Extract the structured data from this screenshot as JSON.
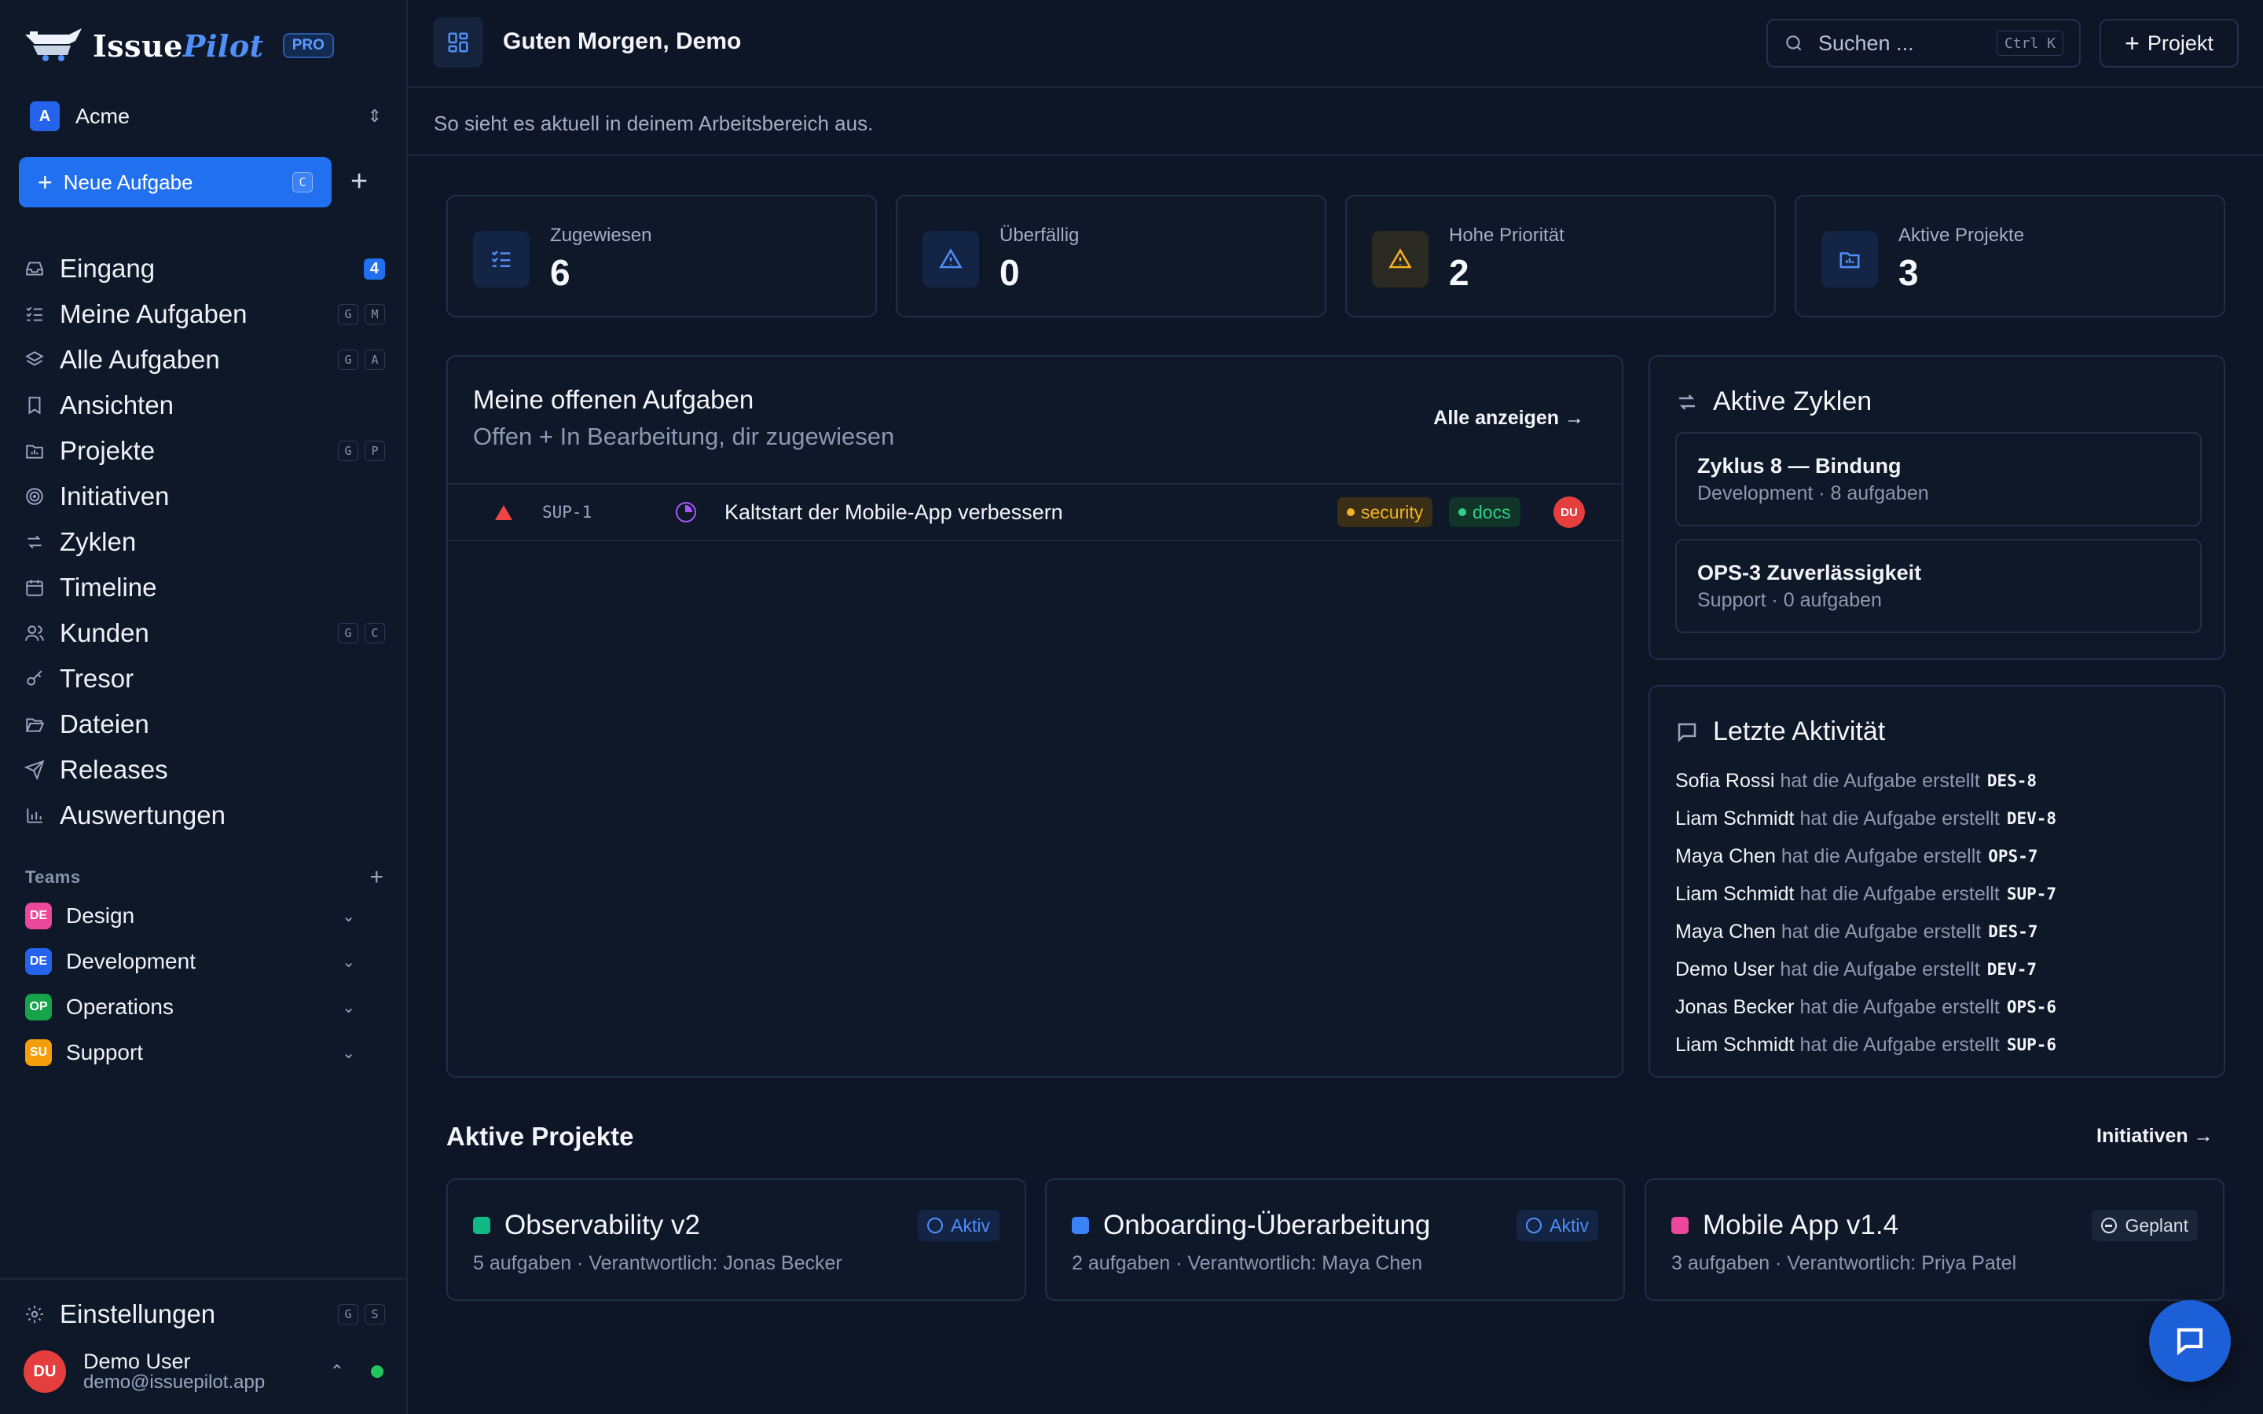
{
  "app": {
    "logo_text_a": "Issue",
    "logo_text_b": "Pilot",
    "plan_badge": "PRO",
    "workspace_initial": "A",
    "workspace_name": "Acme"
  },
  "sidebar": {
    "new_task_label": "Neue Aufgabe",
    "new_task_shortcut": "C",
    "nav": [
      {
        "label": "Eingang",
        "icon": "inbox-icon",
        "badge": "4",
        "keys": []
      },
      {
        "label": "Meine Aufgaben",
        "icon": "list-check-icon",
        "keys": [
          "G",
          "M"
        ]
      },
      {
        "label": "Alle Aufgaben",
        "icon": "layers-icon",
        "keys": [
          "G",
          "A"
        ]
      },
      {
        "label": "Ansichten",
        "icon": "bookmark-icon",
        "keys": []
      },
      {
        "label": "Projekte",
        "icon": "folder-chart-icon",
        "keys": [
          "G",
          "P"
        ]
      },
      {
        "label": "Initiativen",
        "icon": "target-icon",
        "keys": []
      },
      {
        "label": "Zyklen",
        "icon": "cycle-arrows-icon",
        "keys": []
      },
      {
        "label": "Timeline",
        "icon": "calendar-icon",
        "keys": []
      },
      {
        "label": "Kunden",
        "icon": "users-icon",
        "keys": [
          "G",
          "C"
        ]
      },
      {
        "label": "Tresor",
        "icon": "key-icon",
        "keys": []
      },
      {
        "label": "Dateien",
        "icon": "folder-open-icon",
        "keys": []
      },
      {
        "label": "Releases",
        "icon": "send-icon",
        "keys": []
      },
      {
        "label": "Auswertungen",
        "icon": "bar-chart-icon",
        "keys": []
      }
    ],
    "teams_title": "Teams",
    "teams": [
      {
        "initials": "DE",
        "name": "Design",
        "color": "#ec4899"
      },
      {
        "initials": "DE",
        "name": "Development",
        "color": "#2563eb"
      },
      {
        "initials": "OP",
        "name": "Operations",
        "color": "#16a34a"
      },
      {
        "initials": "SU",
        "name": "Support",
        "color": "#f59e0b"
      }
    ],
    "settings_label": "Einstellungen",
    "settings_keys": [
      "G",
      "S"
    ],
    "user": {
      "initials": "DU",
      "name": "Demo User",
      "email": "demo@issuepilot.app"
    }
  },
  "header": {
    "title": "Guten Morgen, Demo",
    "subtitle": "So sieht es aktuell in deinem Arbeitsbereich aus.",
    "search_placeholder": "Suchen ...",
    "search_shortcut": "Ctrl K",
    "project_button": "Projekt"
  },
  "stats": [
    {
      "label": "Zugewiesen",
      "value": "6",
      "icon": "list-check-icon",
      "color": "#4f8ff7"
    },
    {
      "label": "Überfällig",
      "value": "0",
      "icon": "alert-triangle-icon",
      "color": "#4f8ff7"
    },
    {
      "label": "Hohe Priorität",
      "value": "2",
      "icon": "warning-triangle-icon",
      "color": "#f5b223"
    },
    {
      "label": "Aktive Projekte",
      "value": "3",
      "icon": "folder-chart-icon",
      "color": "#4f8ff7"
    }
  ],
  "open_tasks": {
    "title": "Meine offenen Aufgaben",
    "subtitle": "Offen + In Bearbeitung, dir zugewiesen",
    "link": "Alle anzeigen →",
    "rows": [
      {
        "id": "SUP-1",
        "title": "Kaltstart der Mobile-App verbessern",
        "tags": [
          "security",
          "docs"
        ],
        "assignee": "DU"
      }
    ]
  },
  "cycles": {
    "title": "Aktive Zyklen",
    "items": [
      {
        "title": "Zyklus 8 — Bindung",
        "meta": "Development · 8 aufgaben"
      },
      {
        "title": "OPS-3 Zuverlässigkeit",
        "meta": "Support · 0 aufgaben"
      }
    ]
  },
  "activity": {
    "title": "Letzte Aktivität",
    "action_text": "hat die Aufgabe erstellt",
    "items": [
      {
        "user": "Sofia Rossi",
        "id": "DES-8"
      },
      {
        "user": "Liam Schmidt",
        "id": "DEV-8"
      },
      {
        "user": "Maya Chen",
        "id": "OPS-7"
      },
      {
        "user": "Liam Schmidt",
        "id": "SUP-7"
      },
      {
        "user": "Maya Chen",
        "id": "DES-7"
      },
      {
        "user": "Demo User",
        "id": "DEV-7"
      },
      {
        "user": "Jonas Becker",
        "id": "OPS-6"
      },
      {
        "user": "Liam Schmidt",
        "id": "SUP-6"
      }
    ]
  },
  "projects": {
    "title": "Aktive Projekte",
    "link": "Initiativen →",
    "items": [
      {
        "name": "Observability v2",
        "meta": "5 aufgaben · Verantwortlich: Jonas Becker",
        "status": "Aktiv",
        "color": "#10b981"
      },
      {
        "name": "Onboarding-Überarbeitung",
        "meta": "2 aufgaben · Verantwortlich: Maya Chen",
        "status": "Aktiv",
        "color": "#3b82f6"
      },
      {
        "name": "Mobile App v1.4",
        "meta": "3 aufgaben · Verantwortlich: Priya Patel",
        "status": "Geplant",
        "color": "#ec4899"
      }
    ]
  }
}
